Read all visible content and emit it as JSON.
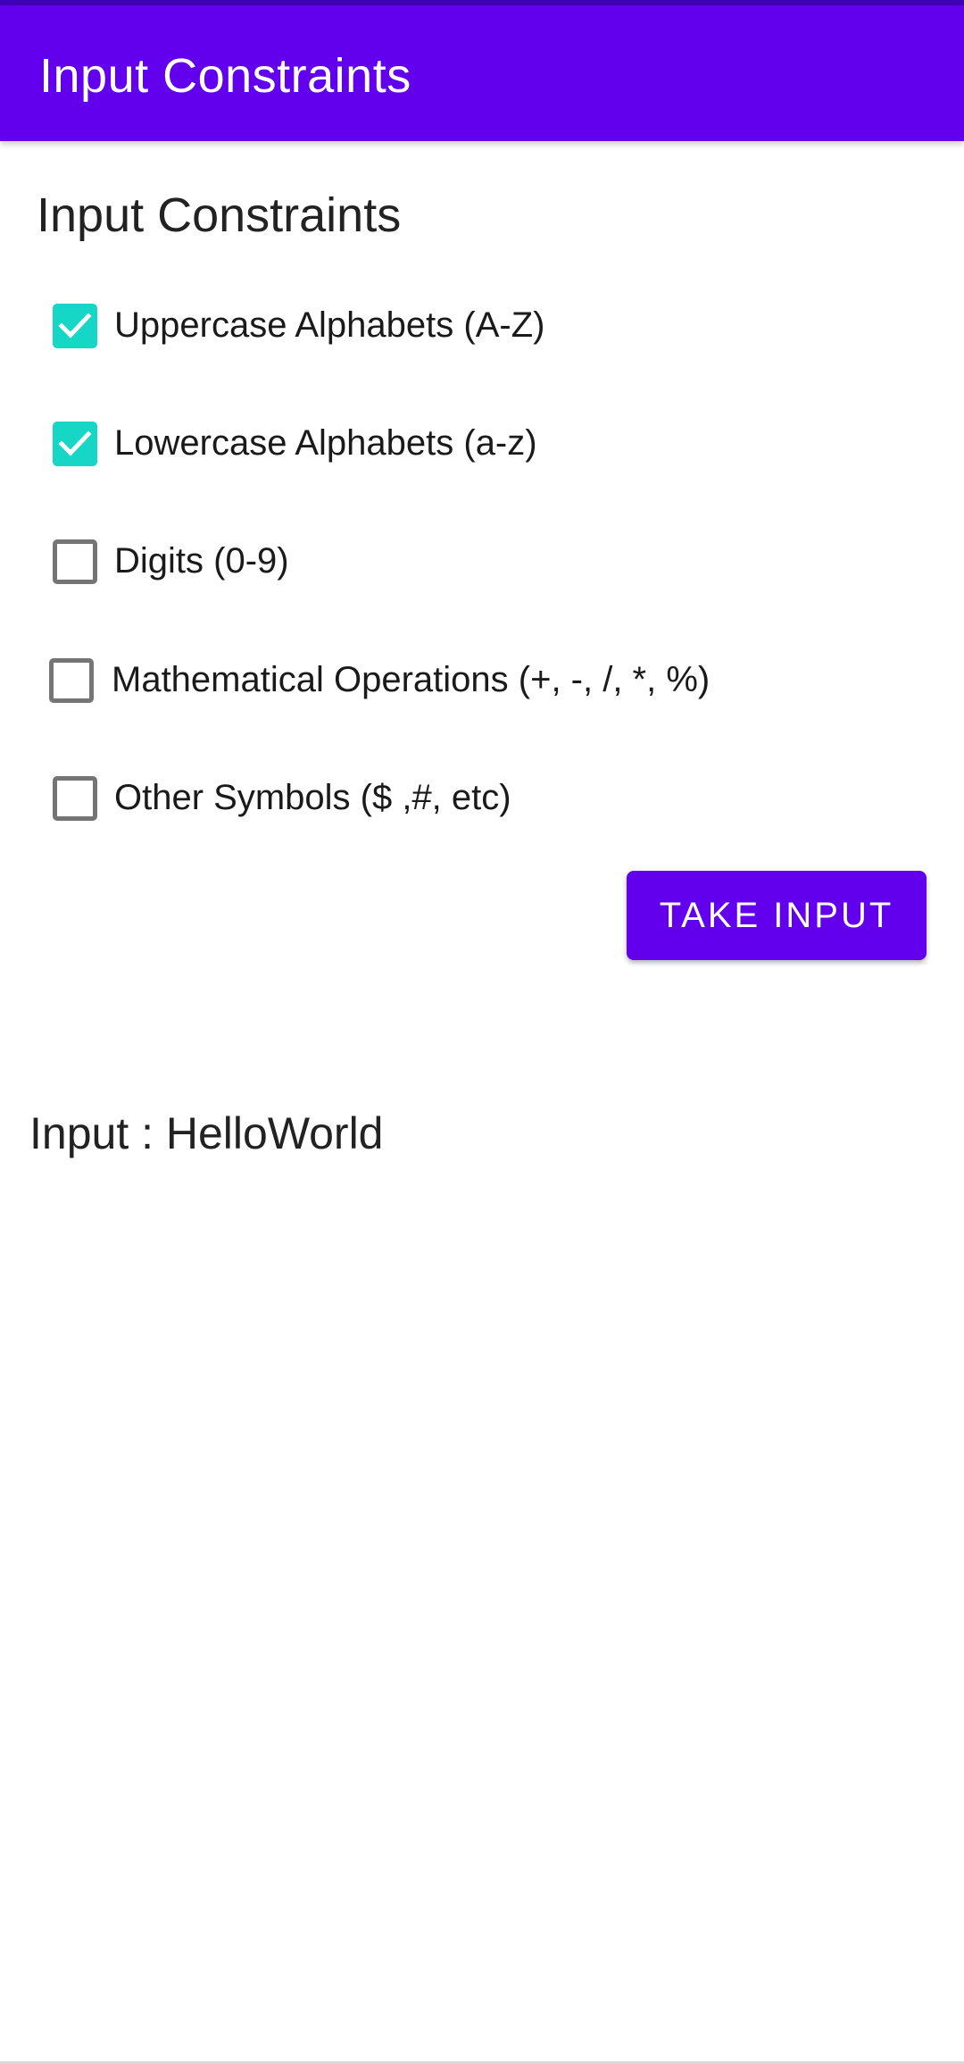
{
  "app_bar": {
    "title": "Input Constraints",
    "background": "#6200ee"
  },
  "section": {
    "title": "Input Constraints"
  },
  "options": [
    {
      "label": "Uppercase Alphabets (A-Z)",
      "checked": true
    },
    {
      "label": "Lowercase Alphabets (a-z)",
      "checked": true
    },
    {
      "label": "Digits (0-9)",
      "checked": false
    },
    {
      "label": "Mathematical Operations (+, -, /, *, %)",
      "checked": false
    },
    {
      "label": "Other Symbols ($ ,#, etc)",
      "checked": false
    }
  ],
  "action": {
    "take_input_label": "TAKE INPUT"
  },
  "result": {
    "text": "Input : HelloWorld"
  },
  "colors": {
    "primary": "#6200ee",
    "checkbox_checked": "#16d7c5",
    "checkbox_unchecked_border": "#757575"
  },
  "icons": {
    "checked": "check-icon"
  }
}
